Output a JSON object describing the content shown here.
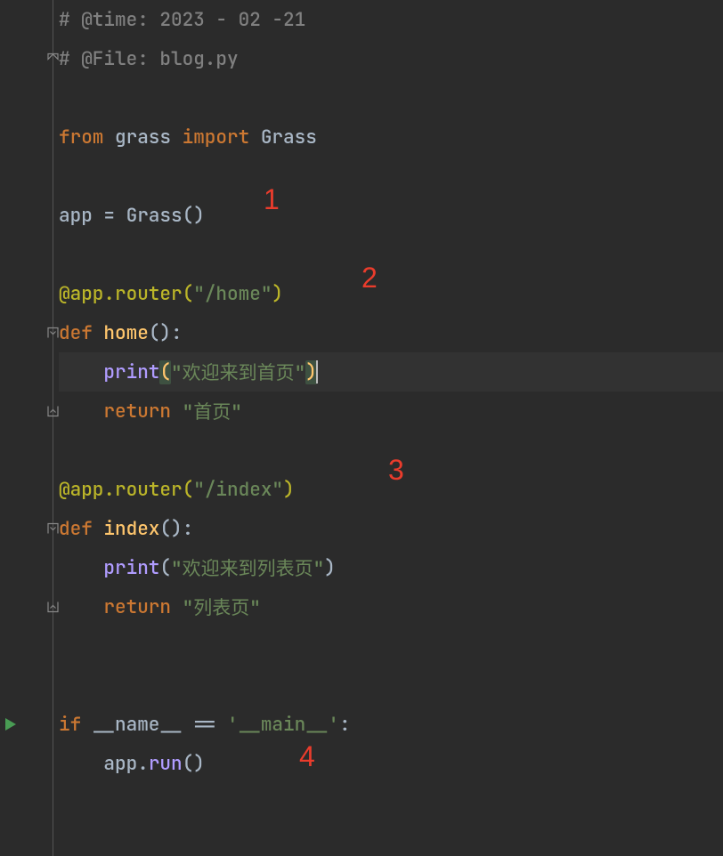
{
  "lines": {
    "l1_comment": "# @time: 2023 - 02 -21",
    "l2_comment": "# @File: blog.py",
    "l4_from": "from ",
    "l4_mod": "grass ",
    "l4_import": "import ",
    "l4_name": "Grass",
    "l6_app": "app ",
    "l6_eq": "= ",
    "l6_grass": "Grass",
    "l6_par": "()",
    "l8_decor": "@app.router",
    "l8_op": "(",
    "l8_str": "\"/home\"",
    "l8_cp": ")",
    "l9_def": "def ",
    "l9_name": "home",
    "l9_par": "():",
    "l10_indent": "    ",
    "l10_print": "print",
    "l10_op": "(",
    "l10_str": "\"欢迎来到首页\"",
    "l10_cp": ")",
    "l11_indent": "    ",
    "l11_return": "return ",
    "l11_str": "\"首页\"",
    "l13_decor": "@app.router",
    "l13_op": "(",
    "l13_str": "\"/index\"",
    "l13_cp": ")",
    "l14_def": "def ",
    "l14_name": "index",
    "l14_par": "():",
    "l15_indent": "    ",
    "l15_print": "print",
    "l15_op": "(",
    "l15_str": "\"欢迎来到列表页\"",
    "l15_cp": ")",
    "l16_indent": "    ",
    "l16_return": "return ",
    "l16_str": "\"列表页\"",
    "l19_if": "if ",
    "l19_name": "__name__ ",
    "l19_eq": "== ",
    "l19_main": "'__main__'",
    "l19_colon": ":",
    "l20_indent": "    ",
    "l20_app": "app.",
    "l20_run": "run",
    "l20_par": "()"
  },
  "annotations": {
    "a1": "1",
    "a2": "2",
    "a3": "3",
    "a4": "4"
  }
}
